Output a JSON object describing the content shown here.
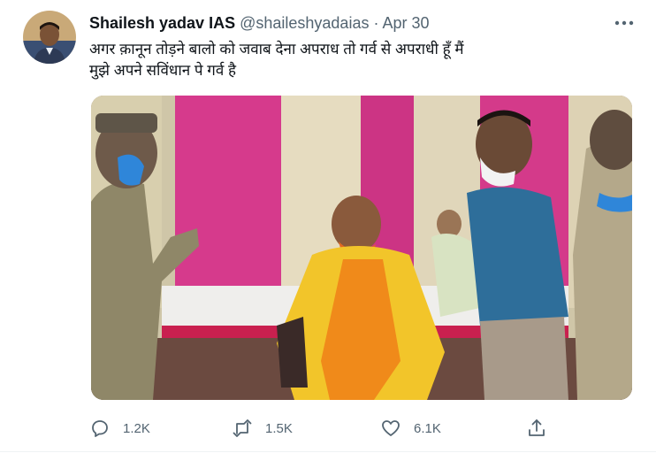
{
  "tweet": {
    "author_name": "Shailesh yadav IAS",
    "handle": "@shaileshyadaias",
    "separator": "·",
    "date": "Apr 30",
    "text_line1": "अगर क़ानून तोड़ने बालो को जवाब देना अपराध तो गर्व से अपराधी हूँ मैं",
    "text_line2": "मुझे अपने सविंधान पे गर्व है",
    "more_icon": "more-horizontal-icon",
    "media": {
      "kind": "video-still",
      "icon": "photo"
    },
    "actions": {
      "reply": {
        "icon": "reply-icon",
        "count": "1.2K"
      },
      "retweet": {
        "icon": "retweet-icon",
        "count": "1.5K"
      },
      "like": {
        "icon": "heart-icon",
        "count": "6.1K"
      },
      "share": {
        "icon": "share-icon"
      }
    }
  },
  "colors": {
    "text": "#0f1419",
    "secondary": "#536471",
    "background": "#ffffff"
  }
}
